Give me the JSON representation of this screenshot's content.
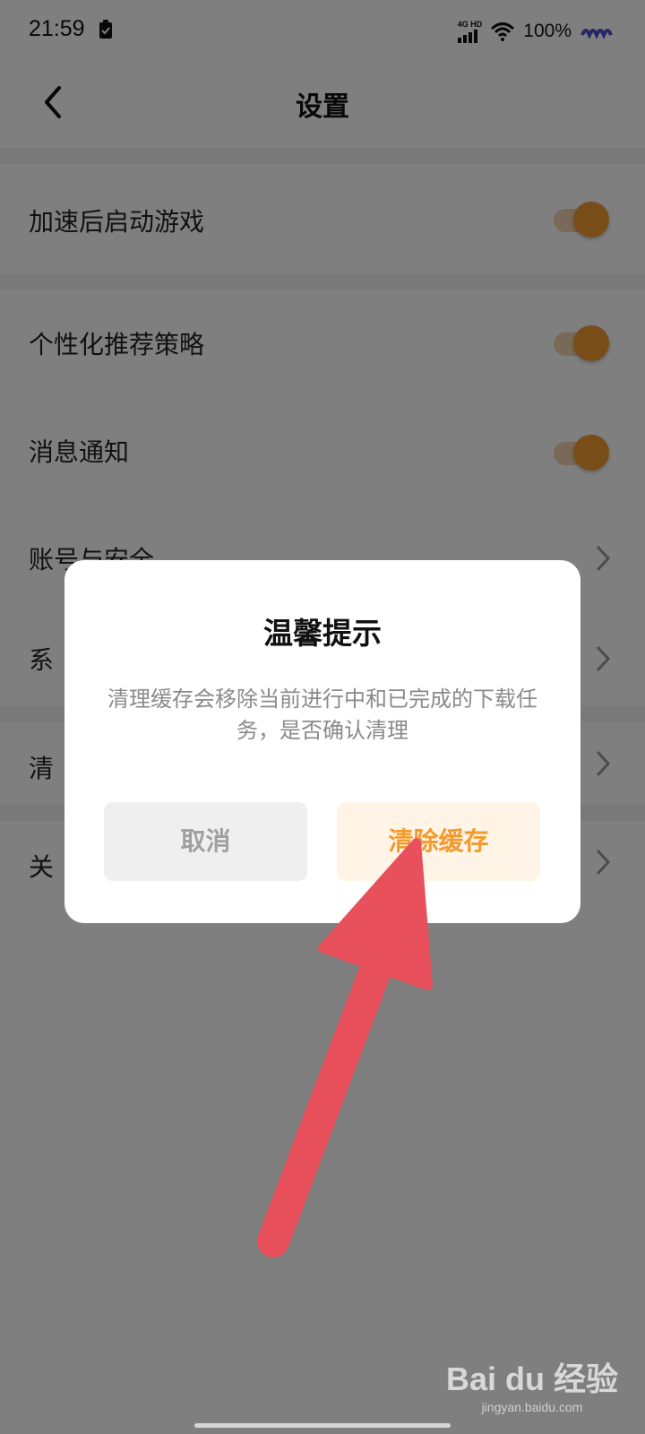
{
  "status_bar": {
    "time": "21:59",
    "network_top": "4G HD",
    "battery": "100%",
    "icons": [
      "clipboard-check-icon",
      "signal-icon",
      "wifi-icon",
      "app-icon"
    ]
  },
  "nav": {
    "title": "设置",
    "back_icon": "chevron-left-icon"
  },
  "settings": {
    "launch_game_after_speedup": "加速后启动游戏",
    "personalized_recommendation": "个性化推荐策略",
    "message_notification": "消息通知",
    "account_security": "账号与安全",
    "system_partial": "系",
    "clear_partial": "清",
    "about_partial": "关"
  },
  "dialog": {
    "title": "温馨提示",
    "message": "清理缓存会移除当前进行中和已完成的下载任务，是否确认清理",
    "cancel_label": "取消",
    "confirm_label": "清除缓存"
  },
  "watermark": {
    "logo": "Bai du 经验",
    "sub": "jingyan.baidu.com"
  },
  "colors": {
    "accent": "#f39a2e",
    "arrow": "#e8505b",
    "overlay": "rgba(0,0,0,0.5)"
  }
}
